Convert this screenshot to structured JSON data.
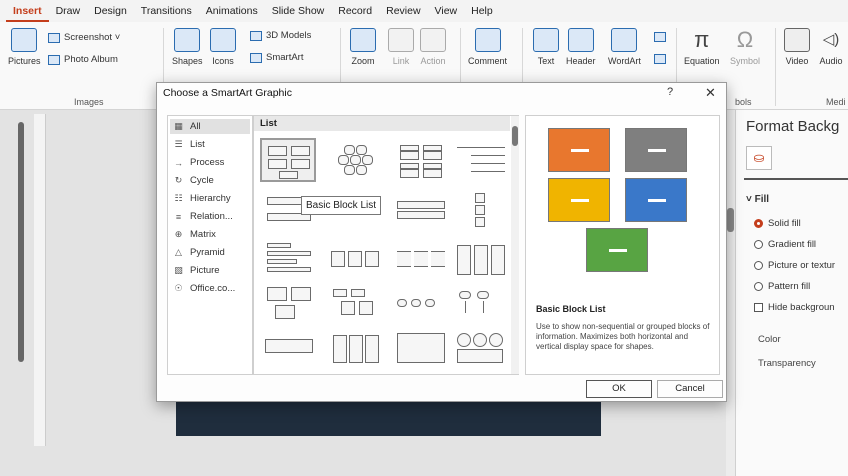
{
  "menu": [
    "Insert",
    "Draw",
    "Design",
    "Transitions",
    "Animations",
    "Slide Show",
    "Record",
    "Review",
    "View",
    "Help"
  ],
  "ribbon": {
    "pictures": "Pictures",
    "screenshot": "Screenshot ˅",
    "photo_album": "Photo Album",
    "shapes": "Shapes",
    "icons": "Icons",
    "models_3d": "3D Models",
    "smartart": "SmartArt",
    "zoom": "Zoom",
    "link": "Link",
    "action": "Action",
    "comment": "Comment",
    "text": "Text",
    "header": "Header",
    "wordart": "WordArt",
    "equation": "Equation",
    "symbol": "Symbol",
    "video": "Video",
    "audio": "Audio",
    "group_images": "Images",
    "group_symbols": "bols",
    "group_media": "Medi"
  },
  "dialog": {
    "title": "Choose a SmartArt Graphic",
    "help": "?",
    "close": "✕",
    "categories": [
      {
        "label": "All",
        "icon": "▦",
        "selected": true
      },
      {
        "label": "List",
        "icon": "☰",
        "selected": false
      },
      {
        "label": "Process",
        "icon": "→",
        "selected": false
      },
      {
        "label": "Cycle",
        "icon": "↻",
        "selected": false
      },
      {
        "label": "Hierarchy",
        "icon": "☷",
        "selected": false
      },
      {
        "label": "Relation...",
        "icon": "≡",
        "selected": false
      },
      {
        "label": "Matrix",
        "icon": "⊕",
        "selected": false
      },
      {
        "label": "Pyramid",
        "icon": "△",
        "selected": false
      },
      {
        "label": "Picture",
        "icon": "▧",
        "selected": false
      },
      {
        "label": "Office.co...",
        "icon": "☉",
        "selected": false
      }
    ],
    "gallery_header": "List",
    "tooltip": "Basic Block List",
    "preview": {
      "name": "Basic Block List",
      "description": "Use to show non-sequential or grouped blocks of information. Maximizes both horizontal and vertical display space for shapes.",
      "colors": [
        "#e8772e",
        "#7f7f7f",
        "#f0b400",
        "#3a78c9",
        "#58a443"
      ]
    },
    "ok_label": "OK",
    "cancel_label": "Cancel"
  },
  "format_pane": {
    "title": "Format Backg",
    "fill_header": "˅ Fill",
    "options": [
      "Solid fill",
      "Gradient fill",
      "Picture or textur",
      "Pattern fill"
    ],
    "hide_background": "Hide backgroun",
    "color_label": "Color",
    "transparency_label": "Transparency"
  }
}
